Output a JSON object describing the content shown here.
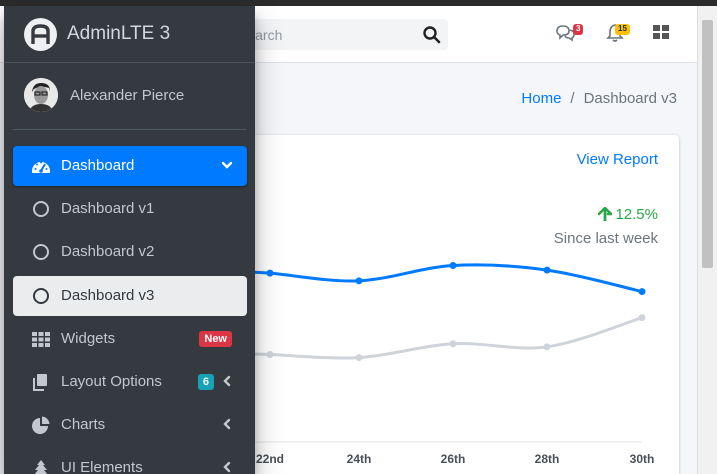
{
  "brand": {
    "name": "AdminLTE 3"
  },
  "user": {
    "name": "Alexander Pierce"
  },
  "search": {
    "placeholder": "Search"
  },
  "topnav": {
    "messages_count": "3",
    "notifications_count": "15"
  },
  "breadcrumb": {
    "home": "Home",
    "separator": "/",
    "current": "Dashboard v3"
  },
  "card": {
    "link": "View Report",
    "change": "12.5%",
    "change_label": "Since last week"
  },
  "sidebar": {
    "items": [
      {
        "label": "Dashboard",
        "icon": "dashboard-gauge-icon"
      },
      {
        "label": "Dashboard v1",
        "icon": "circle-icon"
      },
      {
        "label": "Dashboard v2",
        "icon": "circle-icon"
      },
      {
        "label": "Dashboard v3",
        "icon": "circle-icon"
      },
      {
        "label": "Widgets",
        "icon": "grid-icon",
        "badge": "New"
      },
      {
        "label": "Layout Options",
        "icon": "copy-icon",
        "badge": "6"
      },
      {
        "label": "Charts",
        "icon": "pie-chart-icon"
      },
      {
        "label": "UI Elements",
        "icon": "tree-icon"
      }
    ]
  },
  "colors": {
    "primary": "#007bff",
    "sidebar": "#343a40",
    "success": "#28a745",
    "danger": "#dc3545",
    "info": "#17a2b8",
    "gray_series": "#ced4da"
  },
  "chart_data": {
    "type": "line",
    "x": [
      "22nd",
      "24th",
      "26th",
      "28th",
      "30th"
    ],
    "series": [
      {
        "values": [
          110,
          105,
          115,
          112,
          98
        ]
      },
      {
        "values": [
          57,
          55,
          64,
          62,
          81
        ]
      }
    ],
    "ylim": [
      0,
      200
    ]
  }
}
